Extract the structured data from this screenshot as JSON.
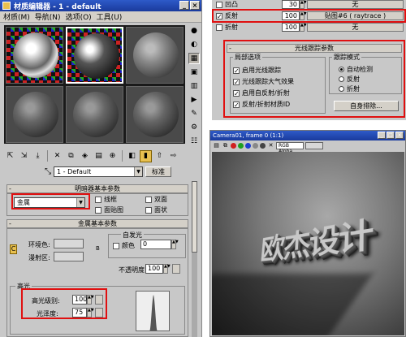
{
  "material_editor": {
    "title": "材质编辑器 - 1 - default",
    "menu": [
      "材质(M)",
      "导航(N)",
      "选项(O)",
      "工具(U)"
    ],
    "slot_count": 6,
    "material_name": "1 - Default",
    "type_button": "标准",
    "shader_rollout": {
      "title": "明暗器基本参数",
      "shader_type": "金属",
      "options": {
        "wire": "线框",
        "two_sided": "双面",
        "face_map": "面贴图",
        "faceted": "面状"
      }
    },
    "metal_rollout": {
      "title": "金属基本参数",
      "ambient_label": "环境色:",
      "diffuse_label": "漫射区:",
      "self_illum_title": "自发光",
      "color_label": "颜色",
      "color_value": "0",
      "opacity_label": "不透明度",
      "opacity_value": "100",
      "lock_label": "C",
      "map_label": "B"
    },
    "highlight": {
      "title": "高光",
      "spec_level_label": "高光级别:",
      "spec_level_value": "100",
      "gloss_label": "光泽度:",
      "gloss_value": "75"
    }
  },
  "raytrace_panel": {
    "rows": [
      {
        "label": "凹凸",
        "value": "30",
        "map": "无",
        "checked": false
      },
      {
        "label": "反射",
        "value": "100",
        "map": "贴图#6  ( raytrace )",
        "checked": true
      },
      {
        "label": "折射",
        "value": "100",
        "map": "无",
        "checked": false
      }
    ],
    "params_title": "光线跟踪参数",
    "local_options_title": "局部选项",
    "local_options": [
      {
        "label": "启用光线跟踪",
        "checked": true
      },
      {
        "label": "光线跟踪大气效果",
        "checked": true
      },
      {
        "label": "启用自反射/折射",
        "checked": true
      },
      {
        "label": "反射/折射材质ID",
        "checked": true
      }
    ],
    "trace_mode_title": "跟踪模式",
    "trace_modes": [
      {
        "label": "自动检测",
        "selected": true
      },
      {
        "label": "反射",
        "selected": false
      },
      {
        "label": "折射",
        "selected": false
      }
    ],
    "exclude_button": "自身排除..."
  },
  "render_window": {
    "title": "Camera01, frame 0 (1:1)",
    "channel_select": "RGB Alpha",
    "render_text": "欧杰设计"
  },
  "colors": {
    "highlight_box": "#e01010",
    "title_bar": "#1a3a9c",
    "panel_bg": "#c8c8c8"
  }
}
